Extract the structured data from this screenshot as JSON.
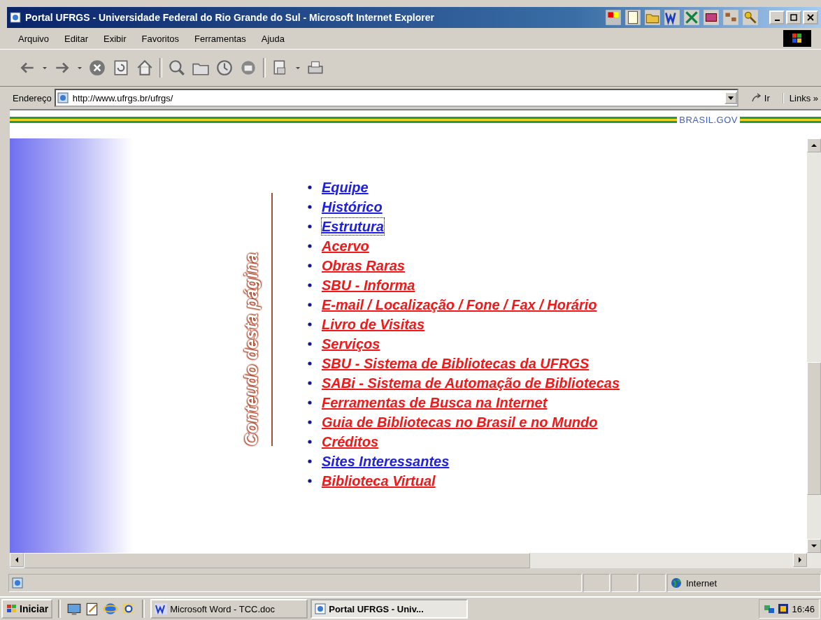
{
  "window": {
    "title": "Portal UFRGS - Universidade Federal do Rio Grande do Sul - Microsoft Internet Explorer"
  },
  "menu": [
    "Arquivo",
    "Editar",
    "Exibir",
    "Favoritos",
    "Ferramentas",
    "Ajuda"
  ],
  "address_bar": {
    "label": "Endereço",
    "value": "http://www.ufrgs.br/ufrgs/",
    "go": "Ir",
    "links": "Links »"
  },
  "banner": {
    "label": "BRASIL.GOV"
  },
  "page": {
    "side_heading": "Conteudo desta página",
    "links": [
      {
        "label": "Equipe",
        "color": "#2020e0",
        "focused": false
      },
      {
        "label": "Histórico",
        "color": "#2020e0",
        "focused": false
      },
      {
        "label": "Estrutura",
        "color": "#2020e0",
        "focused": true
      },
      {
        "label": "Acervo",
        "color": "#f01818",
        "focused": false
      },
      {
        "label": "Obras Raras",
        "color": "#f01818",
        "focused": false
      },
      {
        "label": "SBU - Informa",
        "color": "#f01818",
        "focused": false
      },
      {
        "label": "E-mail / Localização / Fone / Fax / Horário",
        "color": "#f01818",
        "focused": false
      },
      {
        "label": "Livro de Visitas",
        "color": "#f01818",
        "focused": false
      },
      {
        "label": "Serviços",
        "color": "#f01818",
        "focused": false
      },
      {
        "label": "SBU - Sistema de Bibliotecas da UFRGS",
        "color": "#f01818",
        "focused": false
      },
      {
        "label": "SABi - Sistema de Automação de Bibliotecas",
        "color": "#f01818",
        "focused": false
      },
      {
        "label": "Ferramentas de Busca na Internet",
        "color": "#f01818",
        "focused": false
      },
      {
        "label": "Guia de Bibliotecas no Brasil e no Mundo",
        "color": "#f01818",
        "focused": false
      },
      {
        "label": "Créditos",
        "color": "#f01818",
        "focused": false
      },
      {
        "label": "Sites Interessantes",
        "color": "#2020e0",
        "focused": false
      },
      {
        "label": "Biblioteca Virtual",
        "color": "#f01818",
        "focused": false
      }
    ]
  },
  "status_bar": {
    "zone": "Internet"
  },
  "taskbar": {
    "start": "Iniciar",
    "tasks": [
      {
        "label": "Microsoft Word - TCC.doc",
        "kind": "word",
        "selected": false
      },
      {
        "label": "Portal UFRGS - Univ...",
        "kind": "browser",
        "selected": true
      }
    ],
    "clock": "16:46"
  }
}
